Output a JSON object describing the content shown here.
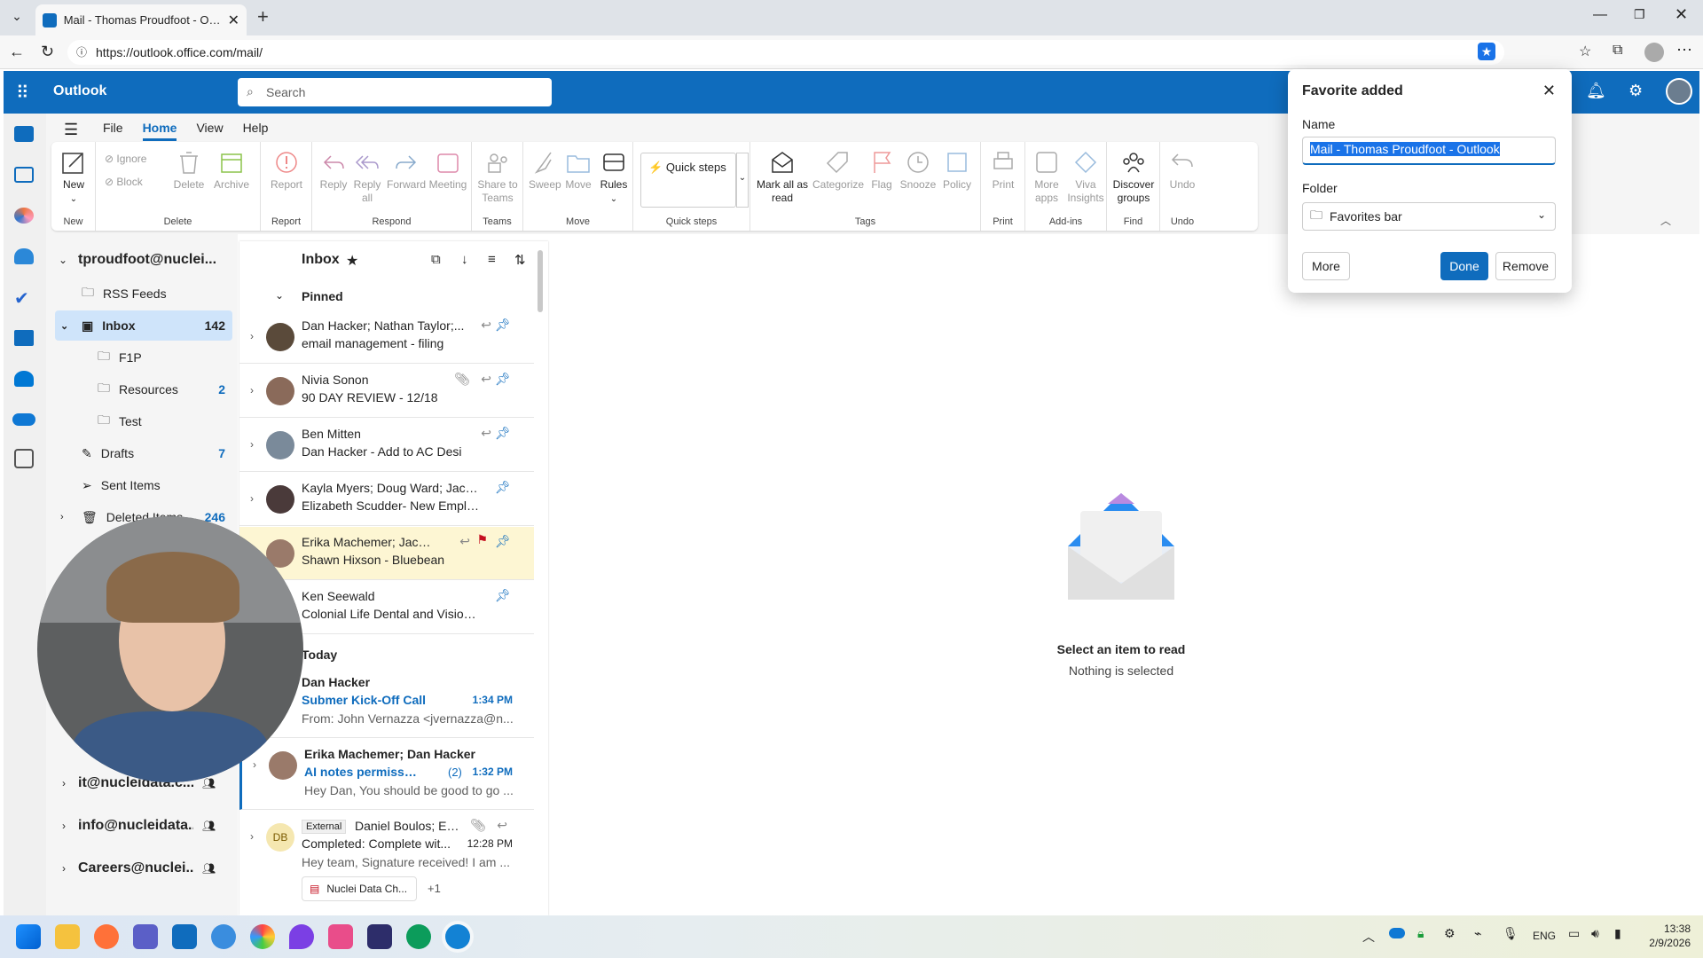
{
  "browser": {
    "tab_title": "Mail - Thomas Proudfoot - Outlook",
    "url": "https://outlook.office.com/mail/"
  },
  "app": {
    "name": "Outlook",
    "search_placeholder": "Search"
  },
  "menu": [
    "File",
    "Home",
    "View",
    "Help"
  ],
  "ribbon": {
    "groups": [
      {
        "label": "New",
        "buttons": [
          "New"
        ]
      },
      {
        "label": "Delete",
        "buttons": [
          "Ignore",
          "Block",
          "Delete",
          "Archive"
        ]
      },
      {
        "label": "Report",
        "buttons": [
          "Report"
        ]
      },
      {
        "label": "Respond",
        "buttons": [
          "Reply",
          "Reply all",
          "Forward",
          "Meeting"
        ]
      },
      {
        "label": "Teams",
        "buttons": [
          "Share to Teams"
        ]
      },
      {
        "label": "Move",
        "buttons": [
          "Sweep",
          "Move",
          "Rules"
        ]
      },
      {
        "label": "Quick steps",
        "buttons": [
          "Quick steps"
        ]
      },
      {
        "label": "Tags",
        "buttons": [
          "Mark all as read",
          "Categorize",
          "Flag",
          "Snooze",
          "Policy"
        ]
      },
      {
        "label": "Print",
        "buttons": [
          "Print"
        ]
      },
      {
        "label": "Add-ins",
        "buttons": [
          "More apps",
          "Viva Insights"
        ]
      },
      {
        "label": "Find",
        "buttons": [
          "Discover groups"
        ]
      },
      {
        "label": "Undo",
        "buttons": [
          "Undo"
        ]
      }
    ]
  },
  "folders": {
    "account": "tproudfoot@nuclei...",
    "items": [
      {
        "name": "RSS Feeds",
        "count": ""
      },
      {
        "name": "Inbox",
        "count": "142"
      },
      {
        "name": "F1P",
        "count": ""
      },
      {
        "name": "Resources",
        "count": "2"
      },
      {
        "name": "Test",
        "count": ""
      },
      {
        "name": "Drafts",
        "count": "7"
      },
      {
        "name": "Sent Items",
        "count": ""
      },
      {
        "name": "Deleted Items",
        "count": "246"
      }
    ],
    "groups": [
      "it@nucleidata.c...",
      "info@nucleidata....",
      "Careers@nuclei..."
    ]
  },
  "inbox": {
    "title": "Inbox",
    "pinned_label": "Pinned",
    "today_label": "Today",
    "pinned": [
      {
        "from": "Dan Hacker; Nathan Taylor;...",
        "subject": "email management - filing"
      },
      {
        "from": "Nivia Sonon",
        "subject": "90 DAY REVIEW - 12/18"
      },
      {
        "from": "Ben Mitten",
        "subject": "Dan Hacker - Add to AC Desi"
      },
      {
        "from": "Kayla Myers; Doug Ward; Jacki...",
        "subject": "Elizabeth Scudder- New Employe"
      },
      {
        "from": "Erika Machemer; Jackie...",
        "subject": "Shawn Hixson - Bluebean"
      },
      {
        "from": "Ken Seewald",
        "subject": "Colonial Life Dental and Vision Li"
      }
    ],
    "today": [
      {
        "from": "Dan Hacker",
        "subject": "Submer Kick-Off Call",
        "time": "1:34 PM",
        "preview": "From: John Vernazza <jvernazza@n..."
      },
      {
        "from": "Erika Machemer; Dan Hacker",
        "subject": "AI notes permission",
        "count": "(2)",
        "time": "1:32 PM",
        "preview": "Hey Dan, You should be good to go ..."
      },
      {
        "tag": "External",
        "from": "Daniel Boulos; Eri...",
        "initials": "DB",
        "subject": "Completed: Complete wit...",
        "time": "12:28 PM",
        "preview": "Hey team, Signature received! I am ...",
        "attachment": "Nuclei Data Ch...",
        "more": "+1"
      }
    ]
  },
  "reading": {
    "title": "Select an item to read",
    "subtitle": "Nothing is selected"
  },
  "popup": {
    "title": "Favorite added",
    "name_label": "Name",
    "name_value": "Mail - Thomas Proudfoot - Outlook",
    "folder_label": "Folder",
    "folder_value": "Favorites bar",
    "more": "More",
    "done": "Done",
    "remove": "Remove"
  },
  "taskbar": {
    "lang": "ENG",
    "time": "13:38",
    "date": "2/9/2026"
  },
  "colors": {
    "accent": "#0f6cbd",
    "pinned_highlight": "#fdf6d3",
    "flag": "#c50f1f"
  }
}
